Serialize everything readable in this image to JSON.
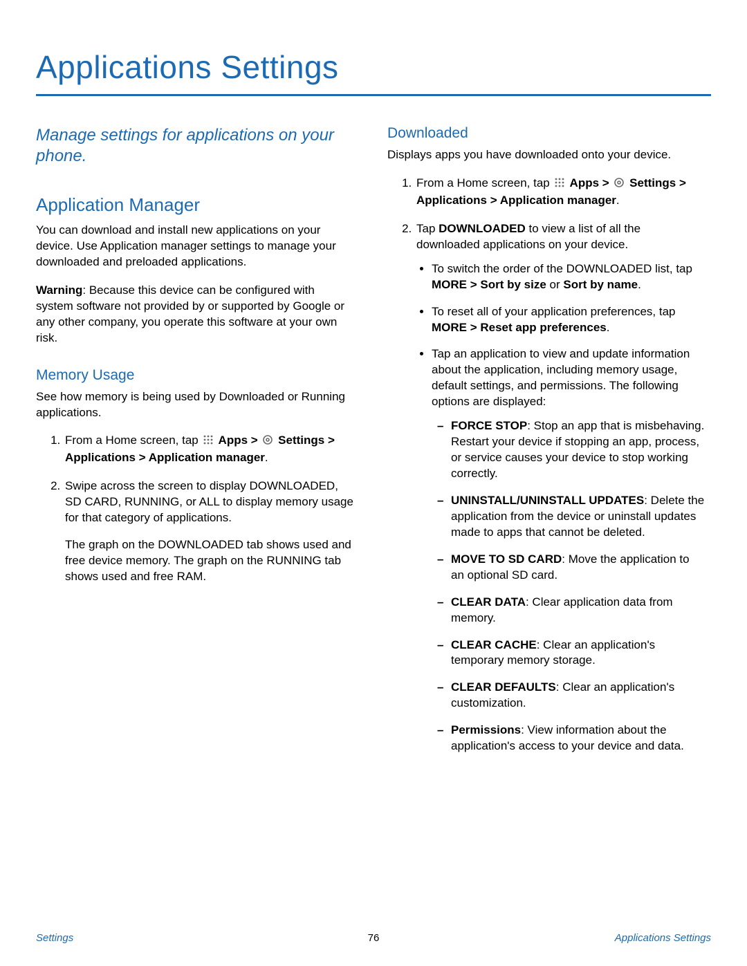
{
  "title": "Applications Settings",
  "intro": "Manage settings for applications on your phone.",
  "footer": {
    "left": "Settings",
    "center": "76",
    "right": "Applications Settings"
  },
  "left": {
    "h2": "Application Manager",
    "p1": "You can download and install new applications on your device. Use Application manager settings to manage your downloaded and preloaded applications.",
    "warn_label": "Warning",
    "warn_rest": ": Because this device can be configured with system software not provided by or supported by Google or any other company, you operate this software at your own risk.",
    "h3": "Memory Usage",
    "p2": "See how memory is being used by Downloaded or Running applications.",
    "step1_a": "From a Home screen, tap ",
    "step1_apps": " Apps > ",
    "step1_settings": " Settings > Applications > Application manager",
    "step1_end": ".",
    "step2": "Swipe across the screen to display DOWNLOADED, SD CARD, RUNNING, or ALL to display memory usage for that category of applications.",
    "step2b": "The graph on the DOWNLOADED tab shows used and free device memory. The graph on the RUNNING tab shows used and free RAM."
  },
  "right": {
    "h3": "Downloaded",
    "p1": "Displays apps you have downloaded onto your device.",
    "step1_a": "From a Home screen, tap ",
    "step1_apps": " Apps > ",
    "step1_settings": " Settings > Applications > Application manager",
    "step1_end": ".",
    "step2_a": "Tap ",
    "step2_b": "DOWNLOADED",
    "step2_c": " to view a list of all the downloaded applications on your device.",
    "b1_a": "To switch the order of the DOWNLOADED list, tap ",
    "b1_b": "MORE > Sort by size",
    "b1_c": " or ",
    "b1_d": "Sort by name",
    "b1_e": ".",
    "b2_a": "To reset all of your application preferences, tap ",
    "b2_b": "MORE > Reset app preferences",
    "b2_c": ".",
    "b3": "Tap an application to view and update information about the application, including memory usage, default settings, and permissions. The following options are displayed:",
    "d1_a": "FORCE STOP",
    "d1_b": ": Stop an app that is misbehaving. Restart your device if stopping an app, process, or service causes your device to stop working correctly.",
    "d2_a": "UNINSTALL/UNINSTALL UPDATES",
    "d2_b": ": Delete the application from the device or uninstall updates made to apps that cannot be deleted.",
    "d3_a": "MOVE TO SD CARD",
    "d3_b": ": Move the application to an optional SD card.",
    "d4_a": "CLEAR DATA",
    "d4_b": ": Clear application data from memory.",
    "d5_a": "CLEAR CACHE",
    "d5_b": ": Clear an application's temporary memory storage.",
    "d6_a": "CLEAR DEFAULTS",
    "d6_b": ": Clear an application's customization.",
    "d7_a": "Permissions",
    "d7_b": ": View information about the application's access to your device and data."
  }
}
